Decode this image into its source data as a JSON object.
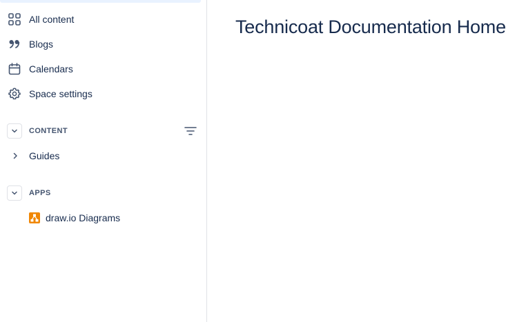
{
  "sidebar": {
    "nav": [
      {
        "label": "All content",
        "icon": "grid-icon"
      },
      {
        "label": "Blogs",
        "icon": "quote-icon"
      },
      {
        "label": "Calendars",
        "icon": "calendar-icon"
      },
      {
        "label": "Space settings",
        "icon": "gear-icon"
      }
    ],
    "content_section": {
      "title": "CONTENT",
      "items": [
        {
          "label": "Guides"
        }
      ]
    },
    "apps_section": {
      "title": "APPS",
      "items": [
        {
          "label": "draw.io Diagrams",
          "icon": "drawio-icon"
        }
      ]
    }
  },
  "main": {
    "title": "Technicoat Documentation Home"
  },
  "colors": {
    "text": "#172b4d",
    "subtle": "#44546f",
    "border": "#dfe1e6",
    "highlight": "#e9f2ff",
    "drawio_orange": "#f08705"
  }
}
